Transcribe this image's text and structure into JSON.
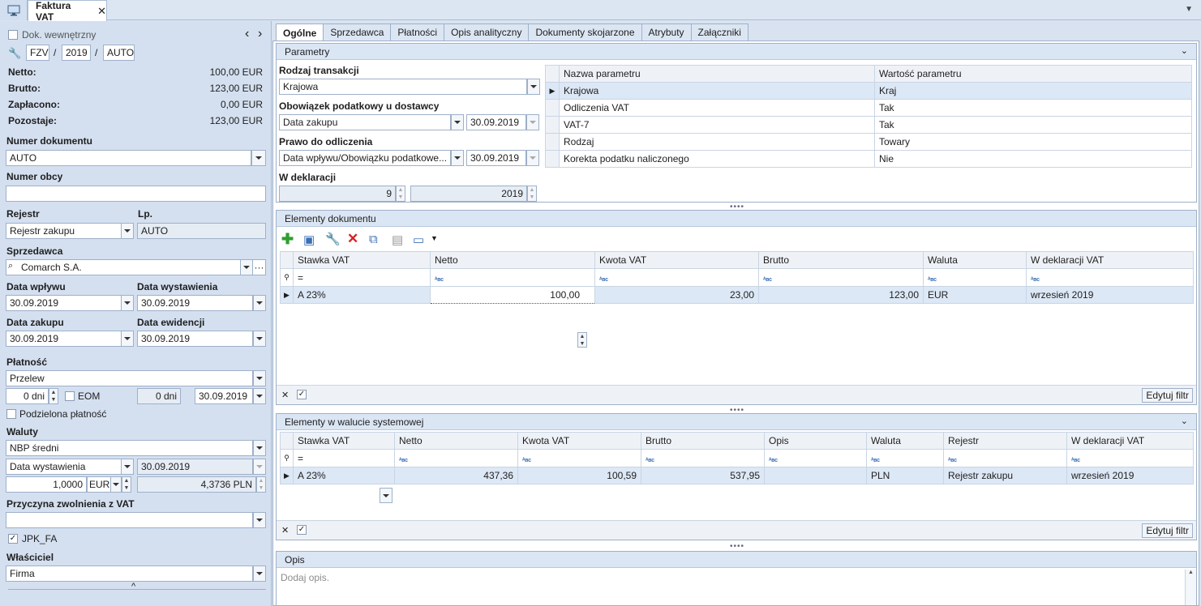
{
  "window": {
    "tab_title": "Faktura VAT",
    "tab_close": "✕"
  },
  "left": {
    "dok_wewnetrzny": "Dok. wewnętrzny",
    "nav_prev": "‹",
    "nav_next": "›",
    "doc_symbol": "FZV",
    "doc_sep1": "/",
    "doc_year": "2019",
    "doc_sep2": "/",
    "doc_number": "AUTO",
    "summary": [
      {
        "label": "Netto:",
        "value": "100,00 EUR"
      },
      {
        "label": "Brutto:",
        "value": "123,00 EUR"
      },
      {
        "label": "Zapłacono:",
        "value": "0,00 EUR"
      },
      {
        "label": "Pozostaje:",
        "value": "123,00 EUR"
      }
    ],
    "numer_dokumentu_label": "Numer dokumentu",
    "numer_dokumentu_value": "AUTO",
    "numer_obcy_label": "Numer obcy",
    "numer_obcy_value": "",
    "rejestr_label": "Rejestr",
    "rejestr_value": "Rejestr zakupu",
    "lp_label": "Lp.",
    "lp_value": "AUTO",
    "sprzedawca_label": "Sprzedawca",
    "sprzedawca_value": "Comarch S.A.",
    "sprzedawca_more": "···",
    "data_wplywu_label": "Data wpływu",
    "data_wplywu_value": "30.09.2019",
    "data_wystawienia_label": "Data wystawienia",
    "data_wystawienia_value": "30.09.2019",
    "data_zakupu_label": "Data zakupu",
    "data_zakupu_value": "30.09.2019",
    "data_ewidencji_label": "Data ewidencji",
    "data_ewidencji_value": "30.09.2019",
    "platnosc_label": "Płatność",
    "platnosc_value": "Przelew",
    "termin_dni": "0 dni",
    "eom_label": "EOM",
    "termin_dni2": "0 dni",
    "termin_data": "30.09.2019",
    "podzielona_label": "Podzielona płatność",
    "waluty_label": "Waluty",
    "kurs_typ": "NBP średni",
    "kurs_data_typ": "Data wystawienia",
    "kurs_data": "30.09.2019",
    "kurs_mnoznik": "1,0000",
    "kurs_waluta": "EUR",
    "kurs_wartosc": "4,3736 PLN",
    "przyczyna_label": "Przyczyna zwolnienia z VAT",
    "przyczyna_value": "",
    "jpk_label": "JPK_FA",
    "wlasciciel_label": "Właściciel",
    "wlasciciel_value": "Firma",
    "collapse_glyph": "^"
  },
  "tabs": [
    "Ogólne",
    "Sprzedawca",
    "Płatności",
    "Opis analityczny",
    "Dokumenty skojarzone",
    "Atrybuty",
    "Załączniki"
  ],
  "parametry": {
    "title": "Parametry",
    "rodzaj_label": "Rodzaj transakcji",
    "rodzaj_value": "Krajowa",
    "obowiazek_label": "Obowiązek podatkowy u dostawcy",
    "obowiazek_value": "Data zakupu",
    "obowiazek_date": "30.09.2019",
    "prawo_label": "Prawo do odliczenia",
    "prawo_value": "Data wpływu/Obowiązku podatkowe...",
    "prawo_date": "30.09.2019",
    "deklaracja_label": "W deklaracji",
    "deklaracja_month": "9",
    "deklaracja_year": "2019",
    "columns": [
      "Nazwa parametru",
      "Wartość parametru"
    ],
    "rows": [
      [
        "Krajowa",
        "Kraj"
      ],
      [
        "Odliczenia VAT",
        "Tak"
      ],
      [
        "VAT-7",
        "Tak"
      ],
      [
        "Rodzaj",
        "Towary"
      ],
      [
        "Korekta podatku naliczonego",
        "Nie"
      ]
    ]
  },
  "elementy": {
    "title": "Elementy dokumentu",
    "columns": [
      "Stawka VAT",
      "Netto",
      "Kwota VAT",
      "Brutto",
      "Waluta",
      "W deklaracji VAT"
    ],
    "filter_eq": "=",
    "abc": "ᴬʙᴄ",
    "rows": [
      [
        "A 23%",
        "100,00",
        "23,00",
        "123,00",
        "EUR",
        "wrzesień 2019"
      ]
    ],
    "edit_filter": "Edytuj filtr"
  },
  "elementy_sys": {
    "title": "Elementy w walucie systemowej",
    "columns": [
      "Stawka VAT",
      "Netto",
      "Kwota VAT",
      "Brutto",
      "Opis",
      "Waluta",
      "Rejestr",
      "W deklaracji VAT"
    ],
    "rows": [
      [
        "A 23%",
        "437,36",
        "100,59",
        "537,95",
        "",
        "PLN",
        "Rejestr zakupu",
        "wrzesień 2019"
      ]
    ],
    "edit_filter": "Edytuj filtr"
  },
  "opis": {
    "title": "Opis",
    "placeholder": "Dodaj opis."
  },
  "grip": "••••",
  "colors": {
    "panel_bg": "#d4e0f0",
    "header_bg": "#dbe6f4",
    "selected_row": "#dde8f6",
    "border": "#9eb0c8"
  }
}
